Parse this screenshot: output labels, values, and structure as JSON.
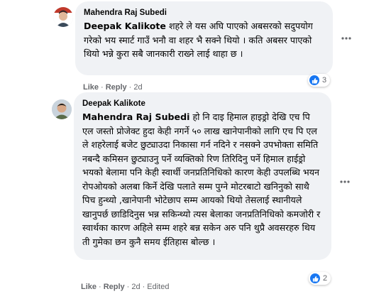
{
  "comments": [
    {
      "author": "Mahendra Raj Subedi",
      "mention": "Deepak Kalikote",
      "text": " शहरे ले यस अघि पाएको अबसरको सदुपयोग गरेको भय स्मार्ट गाउँ भनौ वा शहर भै सक्ने थियो । कति अबसर पाएको थियो भन्ने कुरा सबै जानकारी राख्ने लाई थाहा छ ।",
      "actions": {
        "like": "Like",
        "reply": "Reply",
        "time": "2d"
      },
      "reaction_count": "3"
    },
    {
      "author": "Deepak Kalikote",
      "mention": "Mahendra Raj Subedi",
      "text": " हो नि दाइ हिमाल हाइड्रो देखि एच पि एल जस्तो प्रोजेक्ट हुदा केही नगर्ने ५० लाख खानेपानीको लागि एच पि एल ले शहरेलाई बजेट छुट्याउदा निकासा गर्न नदिने र नसक्ने उपभोक्ता समिति नबन्दै कमिसन छुट्याउनु पर्ने व्यक्तिको रिण तिरिदिनु पर्ने हिमाल हाईड्रो भयको बेलामा पनि केही स्वार्थी जनप्रतिनिधिको कारण केही उपलब्धि भयन रोपओयको अलबा किर्ने देखि पलाते सम्म पुग्ने मोटरबाटो खनिनुको साथै पिच हुन्थ्यो ,खानेपानी भोटेछाप सम्म आयको थियो तेसलाई स्थानीयले खानुपर्छ छाडिदिनुस भन्न सकिन्थ्यो त्यस बेलाका जनप्रतिनिधिको कमजोरी र स्वार्थका कारण अहिले सम्म शहरे बन्न सकेन अरु पनि थुप्रै अवसरहरु थिय ती गुमेका छन कुनै समय ईतिहास बोल्छ ।",
      "actions": {
        "like": "Like",
        "reply": "Reply",
        "time": "2d",
        "edited": "Edited"
      },
      "reaction_count": "2"
    }
  ],
  "icons": {
    "like": "thumbs-up-icon",
    "more": "more-options-icon"
  },
  "colors": {
    "bubble": "#f0f2f5",
    "meta": "#65676b",
    "like_blue": "#1877f2"
  }
}
